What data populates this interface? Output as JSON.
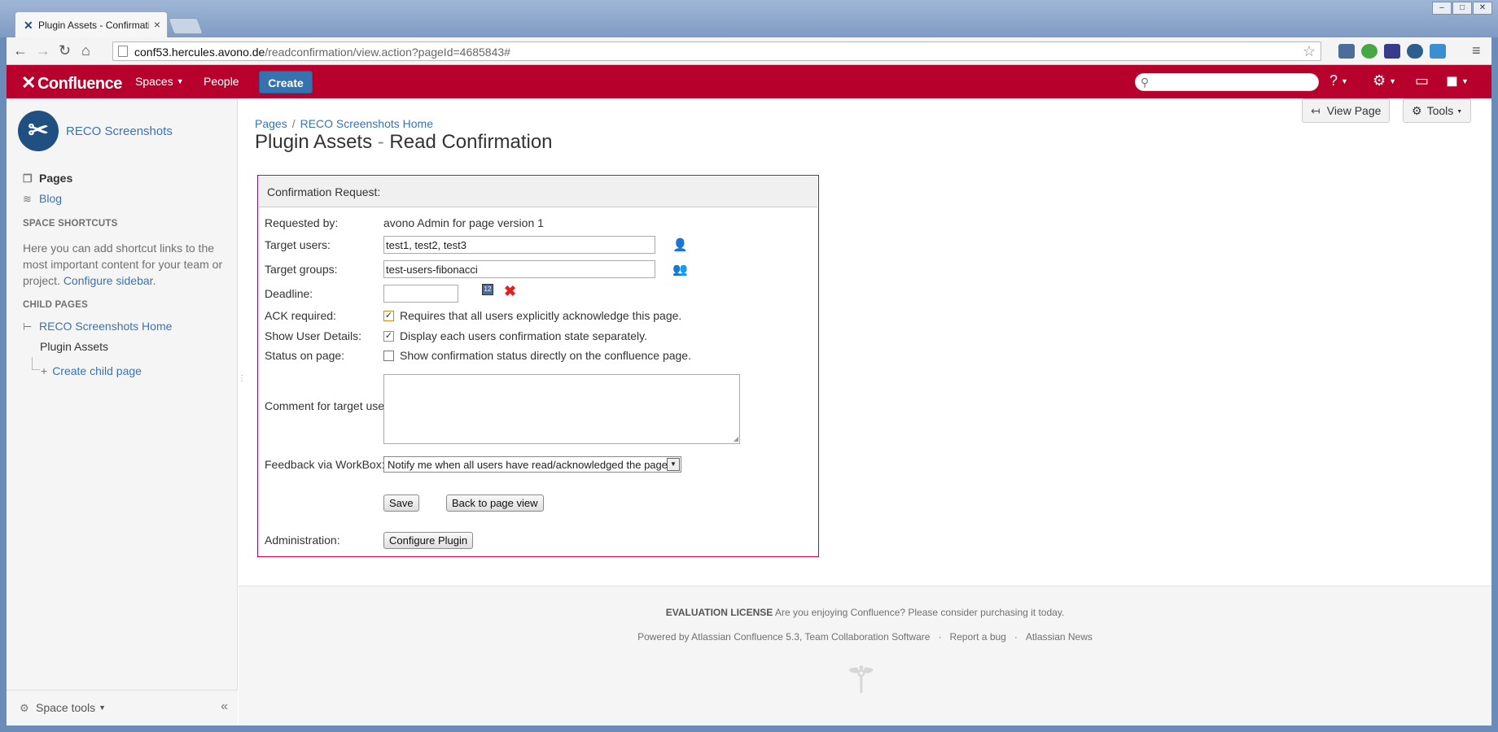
{
  "browser": {
    "tab_title": "Plugin Assets - Confirmati",
    "url_host": "conf53.hercules.avono.de",
    "url_path": "/readconfirmation/view.action?pageId=4685843#"
  },
  "header": {
    "logo": "Confluence",
    "nav": [
      "Spaces",
      "People"
    ],
    "create_label": "Create",
    "search_placeholder": ""
  },
  "sidebar": {
    "space_name": "RECO Screenshots",
    "pages_label": "Pages",
    "blog_label": "Blog",
    "shortcuts_heading": "SPACE SHORTCUTS",
    "shortcuts_text": "Here you can add shortcut links to the most important content for your team or project.",
    "configure_link": "Configure sidebar.",
    "child_pages_heading": "CHILD PAGES",
    "child_home": "RECO Screenshots Home",
    "child_current": "Plugin Assets",
    "create_child": "Create child page",
    "space_tools": "Space tools"
  },
  "breadcrumb": {
    "pages": "Pages",
    "sep": "/",
    "home": "RECO Screenshots Home"
  },
  "page": {
    "title_main": "Plugin Assets",
    "title_dash": " - ",
    "title_sub": "Read Confirmation",
    "view_page": "View Page",
    "tools": "Tools"
  },
  "form": {
    "header": "Confirmation Request:",
    "requested_by_label": "Requested by:",
    "requested_by_value": "avono Admin for page version 1",
    "target_users_label": "Target users:",
    "target_users_value": "test1, test2, test3",
    "target_groups_label": "Target groups:",
    "target_groups_value": "test-users-fibonacci",
    "deadline_label": "Deadline:",
    "deadline_value": "",
    "ack_label": "ACK required:",
    "ack_text": "Requires that all users explicitly acknowledge this page.",
    "ack_checked": true,
    "details_label": "Show User Details:",
    "details_text": "Display each users confirmation state separately.",
    "details_checked": true,
    "status_label": "Status on page:",
    "status_text": "Show confirmation status directly on the confluence page.",
    "status_checked": false,
    "comment_label": "Comment for target users:",
    "feedback_label": "Feedback via WorkBox:",
    "feedback_value": "Notify me when all users have read/acknowledged the page",
    "save": "Save",
    "back": "Back to page view",
    "admin_label": "Administration:",
    "configure": "Configure Plugin"
  },
  "footer": {
    "license_bold": "EVALUATION LICENSE",
    "license_text": " Are you enjoying Confluence? Please consider purchasing it today.",
    "powered": "Powered by Atlassian Confluence 5.3, Team Collaboration Software",
    "report": "Report a bug",
    "news": "Atlassian News"
  },
  "colors": {
    "header": "#b8002d",
    "create": "#3572b0",
    "link": "#3b73af",
    "panel_border": "#c1005a"
  }
}
